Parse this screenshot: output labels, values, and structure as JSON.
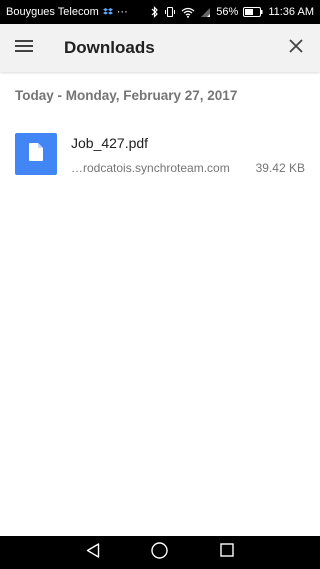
{
  "status_bar": {
    "carrier": "Bouygues Telecom",
    "more": "···",
    "battery": "56%",
    "time": "11:36 AM"
  },
  "app_bar": {
    "title": "Downloads",
    "menu_icon": "hamburger-menu-icon",
    "close_icon": "close-icon"
  },
  "downloads": {
    "date_header": "Today - Monday, February 27, 2017",
    "items": [
      {
        "name": "Job_427.pdf",
        "source": "…rodcatois.synchroteam.com",
        "size": "39.42 KB",
        "icon": "document-icon"
      }
    ]
  },
  "colors": {
    "accent": "#4285f4",
    "app_bar_bg": "#f2f2f2",
    "secondary_text": "#757575"
  },
  "nav_bar": {
    "back_icon": "back-triangle-icon",
    "home_icon": "home-circle-icon",
    "recents_icon": "recents-square-icon"
  }
}
